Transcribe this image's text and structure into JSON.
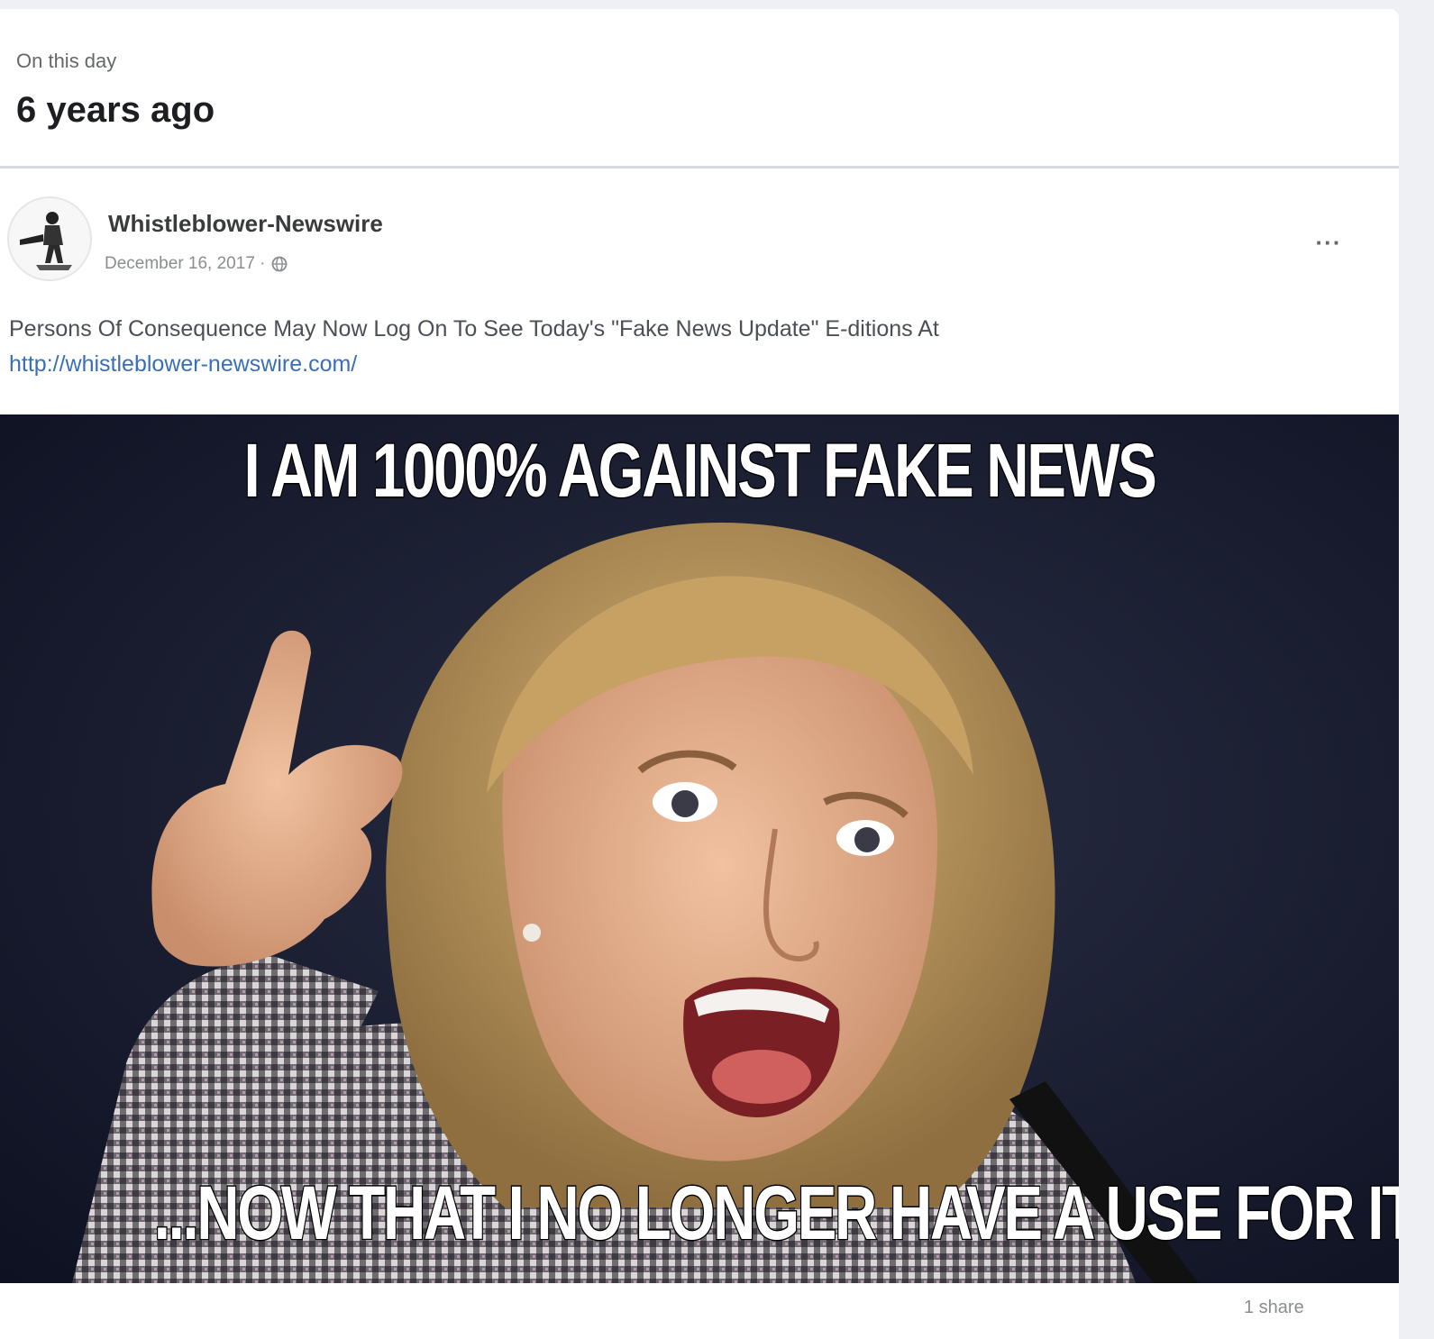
{
  "memory": {
    "label": "On this day",
    "title": "6 years ago"
  },
  "post": {
    "author": "Whistleblower-Newswire",
    "date": "December 16, 2017 ·",
    "privacy_icon": "globe-icon",
    "more_icon": "more-options-icon",
    "more_label": "···",
    "text": "Persons Of Consequence May Now Log On To See Today's \"Fake News Update\"  E-ditions At",
    "link": "http://whistleblower-newswire.com/",
    "image": {
      "top_caption": "I AM 1000% AGAINST FAKE NEWS",
      "bottom_caption": "...NOW THAT I NO LONGER HAVE A USE FOR IT"
    },
    "shares": "1 share"
  },
  "colors": {
    "page_bg": "#eef0f4",
    "card_bg": "#ffffff",
    "link": "#3b6fb5",
    "meta_text": "#8a8d91",
    "meme_text": "#ffffff"
  }
}
